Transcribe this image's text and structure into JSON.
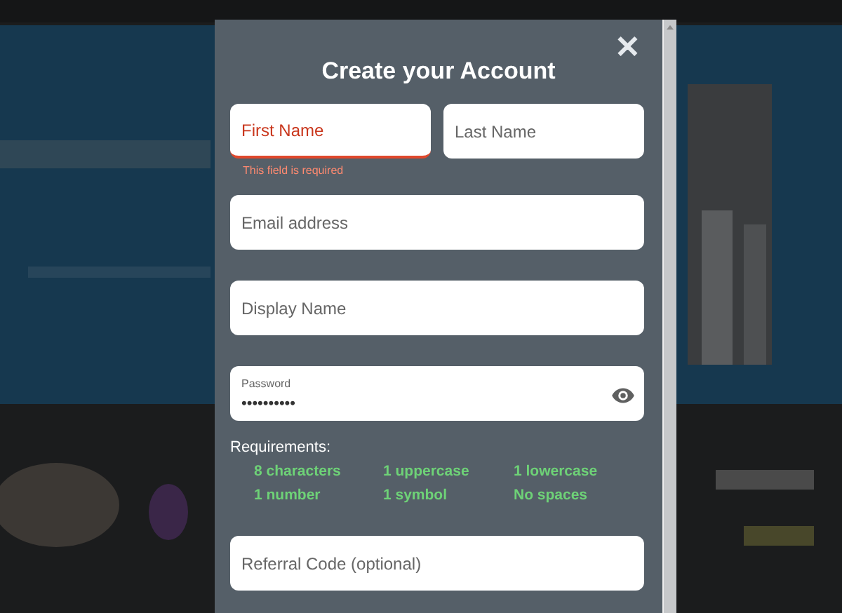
{
  "dialog": {
    "title": "Create your Account",
    "close": "✕"
  },
  "name_fields": [
    {
      "placeholder": "First Name",
      "error": true
    },
    {
      "placeholder": "Last Name",
      "error": false
    }
  ],
  "name_error": "This field is required",
  "fields": [
    {
      "placeholder": "Email address"
    },
    {
      "placeholder": "Display Name"
    }
  ],
  "password": {
    "label": "Password",
    "value": "••••••••••"
  },
  "requirements_title": "Requirements:",
  "requirements": [
    {
      "text": "8 characters",
      "met": true
    },
    {
      "text": "1 uppercase",
      "met": true
    },
    {
      "text": "1 lowercase",
      "met": true
    },
    {
      "text": "1 number",
      "met": true
    },
    {
      "text": "1 symbol",
      "met": true
    },
    {
      "text": "No spaces",
      "met": true
    }
  ],
  "referral": {
    "placeholder": "Referral Code (optional)"
  }
}
